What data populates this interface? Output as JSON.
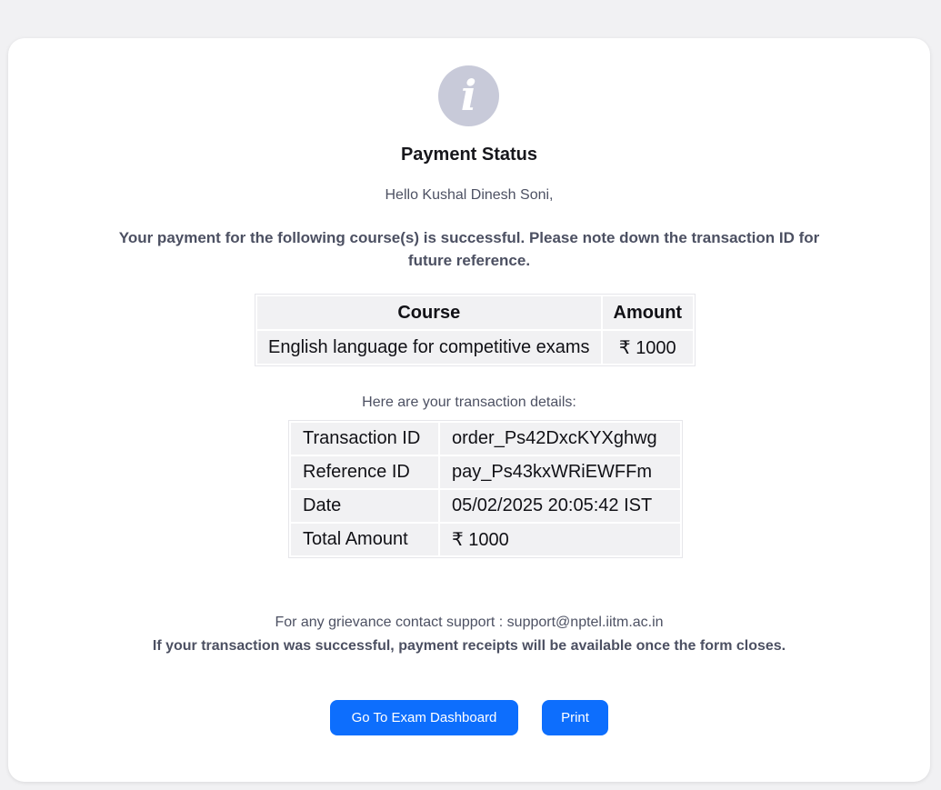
{
  "header": {
    "icon": "info-icon",
    "icon_glyph": "i",
    "title": "Payment Status"
  },
  "greeting": "Hello Kushal Dinesh Soni,",
  "message": "Your payment for the following course(s) is successful. Please note down the transaction ID for future reference.",
  "course_table": {
    "headers": [
      "Course",
      "Amount"
    ],
    "rows": [
      [
        "English language for competitive exams",
        "₹ 1000"
      ]
    ]
  },
  "details_intro": "Here are your transaction details:",
  "details": [
    {
      "label": "Transaction ID",
      "value": "order_Ps42DxcKYXghwg"
    },
    {
      "label": "Reference ID",
      "value": "pay_Ps43kxWRiEWFFm"
    },
    {
      "label": "Date",
      "value": "05/02/2025 20:05:42 IST"
    },
    {
      "label": "Total Amount",
      "value": "₹ 1000"
    }
  ],
  "support_text": "For any grievance contact support : support@nptel.iitm.ac.in",
  "receipt_note": "If your transaction was successful, payment receipts will be available once the form closes.",
  "buttons": {
    "dashboard": "Go To Exam Dashboard",
    "print": "Print"
  },
  "colors": {
    "accent": "#0d6efd",
    "icon_bg": "#c8cad9",
    "page_bg": "#f1f1f3"
  }
}
